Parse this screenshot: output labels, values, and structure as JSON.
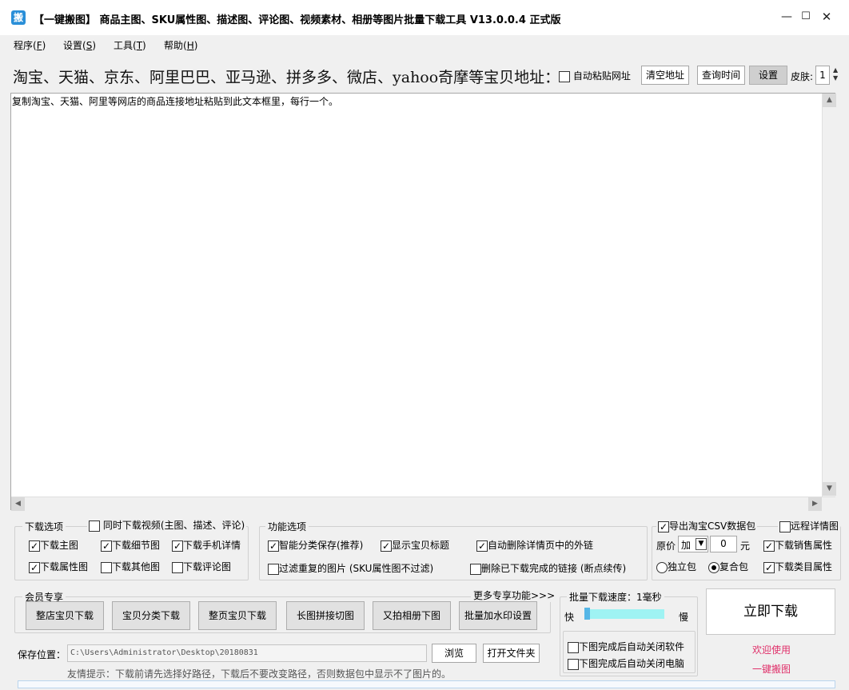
{
  "window": {
    "icon_glyph": "搬",
    "title": "【一键搬图】 商品主图、SKU属性图、描述图、评论图、视频素材、相册等图片批量下载工具 V13.0.0.4 正式版",
    "minimize": "—",
    "maximize": "☐",
    "close": "✕"
  },
  "menu": [
    {
      "label": "程序(",
      "key": "F",
      "end": ")"
    },
    {
      "label": "设置(",
      "key": "S",
      "end": ")"
    },
    {
      "label": "工具(",
      "key": "T",
      "end": ")"
    },
    {
      "label": "帮助(",
      "key": "H",
      "end": ")"
    }
  ],
  "header": {
    "title": "淘宝、天猫、京东、阿里巴巴、亚马逊、拼多多、微店、yahoo奇摩等宝贝地址：",
    "auto_paste": "自动粘贴网址",
    "clear": "清空地址",
    "query_time": "查询时间",
    "settings": "设置",
    "skin_label": "皮肤:",
    "skin_value": "1"
  },
  "textarea": {
    "text": "复制淘宝、天猫、阿里等网店的商品连接地址粘贴到此文本框里，每行一个。"
  },
  "download_options": {
    "title": "下载选项",
    "sync_video": {
      "label": "同时下载视频(主图、描述、评论)",
      "checked": false
    },
    "items": [
      {
        "label": "下载主图",
        "checked": true
      },
      {
        "label": "下载细节图",
        "checked": true
      },
      {
        "label": "下载手机详情",
        "checked": true
      },
      {
        "label": "下载属性图",
        "checked": true
      },
      {
        "label": "下载其他图",
        "checked": false
      },
      {
        "label": "下载评论图",
        "checked": false
      }
    ]
  },
  "function_options": {
    "title": "功能选项",
    "items": [
      {
        "label": "智能分类保存(推荐)",
        "checked": true
      },
      {
        "label": "显示宝贝标题",
        "checked": true
      },
      {
        "label": "自动删除详情页中的外链",
        "checked": true
      },
      {
        "label": "过滤重复的图片 (SKU属性图不过滤)",
        "checked": false
      },
      {
        "label": "删除已下载完成的链接 (断点续传)",
        "checked": false
      }
    ]
  },
  "csv": {
    "export": {
      "label": "导出淘宝CSV数据包",
      "checked": true
    },
    "remote_detail": {
      "label": "远程详情图",
      "checked": false
    },
    "price_label": "原价",
    "price_op": "加",
    "price_value": "0",
    "price_unit": "元",
    "sales_attr": {
      "label": "下载销售属性",
      "checked": true
    },
    "single_pkg": {
      "label": "独立包",
      "checked": false
    },
    "combo_pkg": {
      "label": "复合包",
      "checked": true
    },
    "category_attr": {
      "label": "下载类目属性",
      "checked": true
    }
  },
  "member": {
    "title": "会员专享",
    "more": "更多专享功能>>>",
    "buttons": [
      "整店宝贝下载",
      "宝贝分类下载",
      "整页宝贝下载",
      "长图拼接切图",
      "又拍相册下图",
      "批量加水印设置"
    ]
  },
  "speed": {
    "title": "批量下载速度：1毫秒",
    "fast": "快",
    "slow": "慢",
    "value_fraction": 0.0,
    "close_app": {
      "label": "下图完成后自动关闭软件",
      "checked": false
    },
    "shutdown": {
      "label": "下图完成后自动关闭电脑",
      "checked": false
    }
  },
  "save": {
    "label": "保存位置：",
    "path": "C:\\Users\\Administrator\\Desktop\\20180831",
    "browse": "浏览",
    "open_folder": "打开文件夹",
    "tip": "友情提示：下载前请先选择好路径，下载后不要改变路径，否则数据包中显示不了图片的。"
  },
  "download_now": "立即下载",
  "welcome": {
    "line1": "欢迎使用",
    "line2": "一键搬图"
  },
  "colors": {
    "welcome": "#e0306a",
    "speed_track": "#9ff3f3",
    "speed_thumb": "#55b6e6"
  }
}
